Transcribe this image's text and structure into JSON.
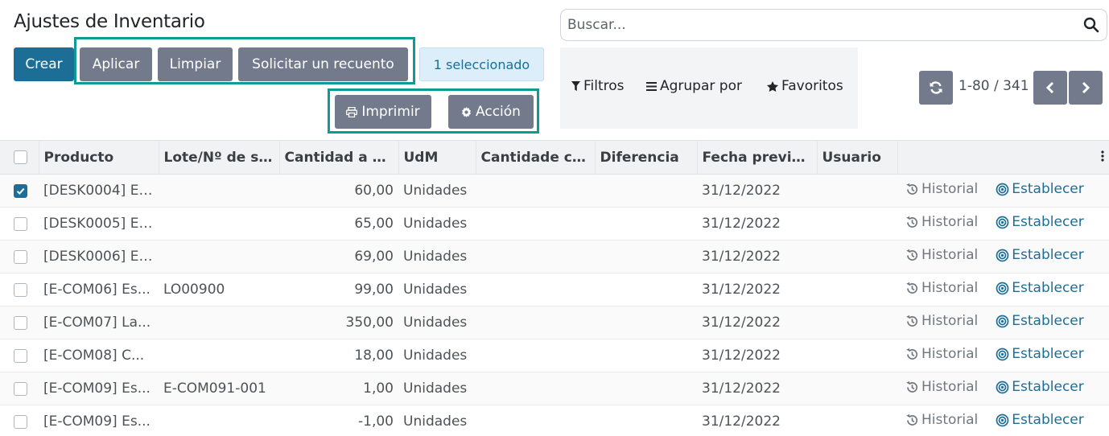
{
  "page_title": "Ajustes de Inventario",
  "toolbar": {
    "create_label": "Crear",
    "apply_label": "Aplicar",
    "clear_label": "Limpiar",
    "request_count_label": "Solicitar un recuento",
    "selected_label": "1 seleccionado",
    "print_label": "Imprimir",
    "action_label": "Acción"
  },
  "search": {
    "placeholder": "Buscar..."
  },
  "filters": {
    "filters_label": "Filtros",
    "group_by_label": "Agrupar por",
    "favorites_label": "Favoritos"
  },
  "pager": {
    "range": "1-80 / 341"
  },
  "table": {
    "columns": [
      "Producto",
      "Lote/Nº de se...",
      "Cantidad a m...",
      "UdM",
      "Cantidade co...",
      "Diferencia",
      "Fecha previst...",
      "Usuario"
    ],
    "history_label": "Historial",
    "set_label": "Establecer",
    "rows": [
      {
        "product": "[DESK0004] Es...",
        "lot": "",
        "qty": "60,00",
        "uom": "Unidades",
        "date": "31/12/2022",
        "checked": true
      },
      {
        "product": "[DESK0005] Es...",
        "lot": "",
        "qty": "65,00",
        "uom": "Unidades",
        "date": "31/12/2022",
        "checked": false
      },
      {
        "product": "[DESK0006] Es...",
        "lot": "",
        "qty": "69,00",
        "uom": "Unidades",
        "date": "31/12/2022",
        "checked": false
      },
      {
        "product": "[E-COM06] Es...",
        "lot": "LO00900",
        "qty": "99,00",
        "uom": "Unidades",
        "date": "31/12/2022",
        "checked": false
      },
      {
        "product": "[E-COM07] La...",
        "lot": "",
        "qty": "350,00",
        "uom": "Unidades",
        "date": "31/12/2022",
        "checked": false
      },
      {
        "product": "[E-COM08] C...",
        "lot": "",
        "qty": "18,00",
        "uom": "Unidades",
        "date": "31/12/2022",
        "checked": false
      },
      {
        "product": "[E-COM09] Es...",
        "lot": "E-COM091-001",
        "qty": "1,00",
        "uom": "Unidades",
        "date": "31/12/2022",
        "checked": false
      },
      {
        "product": "[E-COM09] Es...",
        "lot": "",
        "qty": "-1,00",
        "uom": "Unidades",
        "date": "31/12/2022",
        "checked": false
      }
    ]
  },
  "colors": {
    "primary": "#1c6e96",
    "secondary": "#727a8c",
    "highlight_border": "#0e9b96",
    "selected_badge_bg": "#dceefa"
  }
}
